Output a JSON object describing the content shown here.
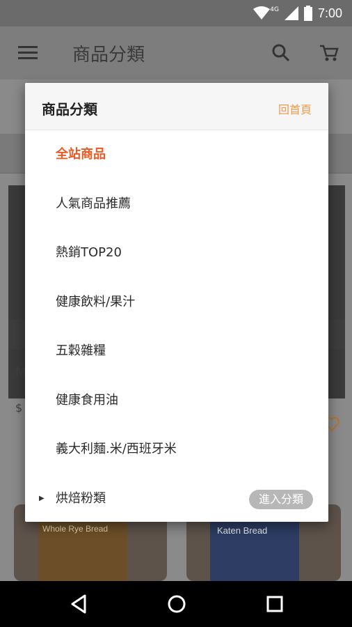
{
  "status_bar": {
    "network": "4G",
    "time": "7:00"
  },
  "app_bar": {
    "title": "商品分類",
    "icons": [
      "menu-icon",
      "search-icon",
      "cart-icon"
    ]
  },
  "dialog": {
    "title": "商品分類",
    "home_link": "回首頁",
    "accent_color": "#ee5a24",
    "items": [
      {
        "label": "全站商品",
        "active": true
      },
      {
        "label": "人氣商品推薦"
      },
      {
        "label": "熱銷TOP20"
      },
      {
        "label": "健康飲料/果汁"
      },
      {
        "label": "五穀雜糧"
      },
      {
        "label": "健康食用油"
      },
      {
        "label": "義大利麵.米/西班牙米"
      },
      {
        "label": "烘焙粉類",
        "has_children": true,
        "action": "進入分類"
      }
    ]
  },
  "background": {
    "product_covers": [
      "Whole Rye Bread",
      "Katen Bread"
    ],
    "left_partial": "M",
    "left_partial_price": "$"
  },
  "nav_bar": {
    "icons": [
      "back-icon",
      "home-icon",
      "recents-icon"
    ]
  }
}
